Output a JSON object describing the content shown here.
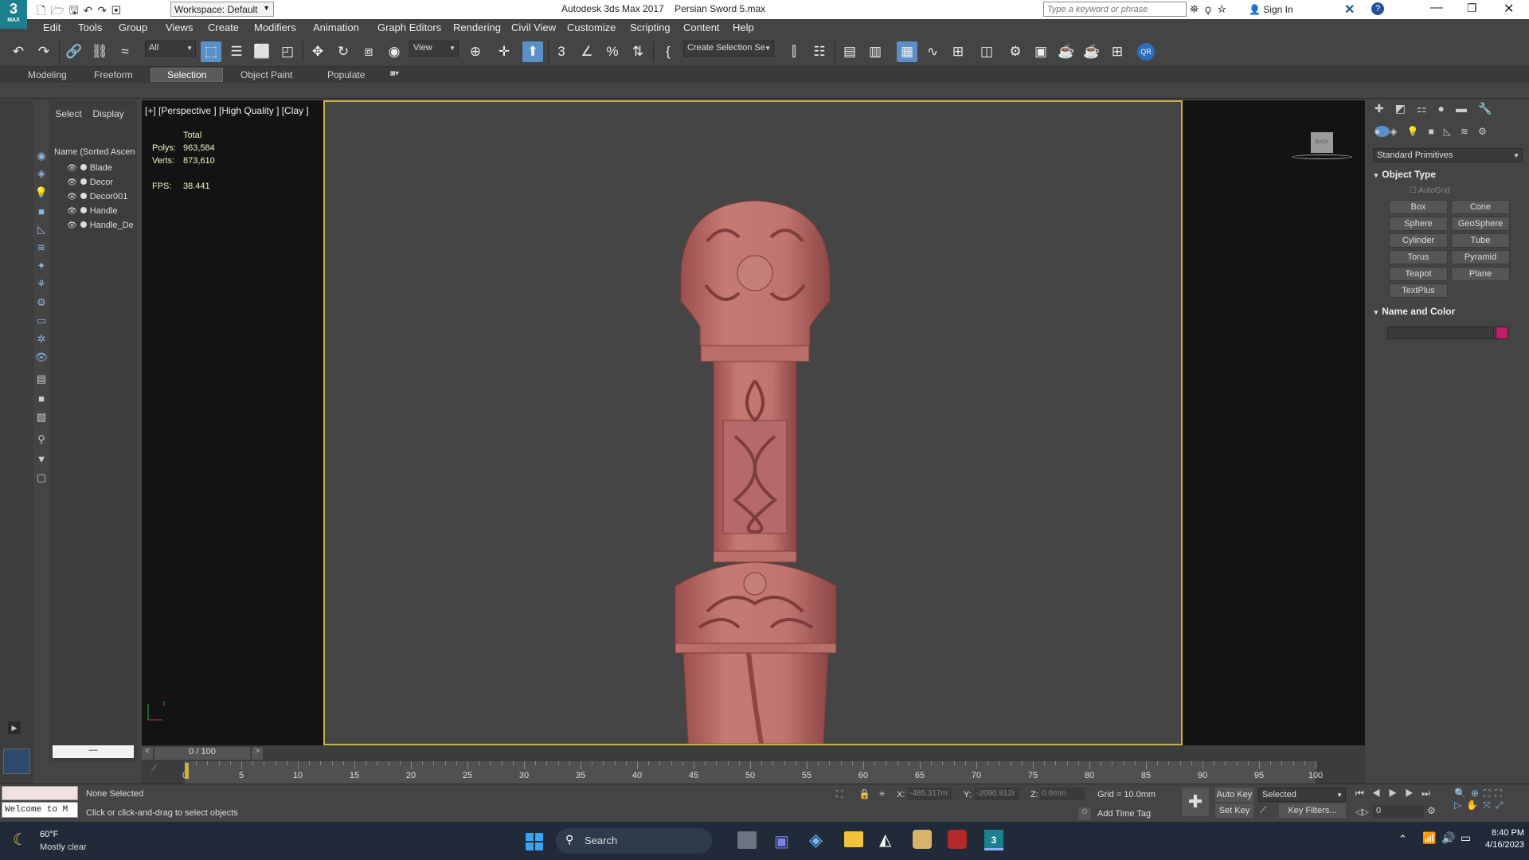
{
  "app": {
    "title": "Autodesk 3ds Max 2017",
    "file": "Persian Sword 5.max",
    "workspace": "Workspace: Default",
    "search_placeholder": "Type a keyword or phrase",
    "sign_in": "Sign In",
    "logo_text": "MAX"
  },
  "menus": [
    "Edit",
    "Tools",
    "Group",
    "Views",
    "Create",
    "Modifiers",
    "Animation",
    "Graph Editors",
    "Rendering",
    "Civil View",
    "Customize",
    "Scripting",
    "Content",
    "Help"
  ],
  "toolbar": {
    "filter_value": "All",
    "ref_coord": "View",
    "selection_set_placeholder": "Create Selection Se"
  },
  "ribbon": {
    "tabs": [
      "Modeling",
      "Freeform",
      "Selection",
      "Object Paint",
      "Populate"
    ],
    "active": "Selection"
  },
  "scene_explorer": {
    "tabs": [
      "Select",
      "Display"
    ],
    "header": "Name (Sorted Ascen",
    "items": [
      "Blade",
      "Decor",
      "Decor001",
      "Handle",
      "Handle_De"
    ]
  },
  "viewport": {
    "label": "[+] [Perspective ] [High Quality ] [Clay ]",
    "stats": {
      "total_label": "Total",
      "polys_label": "Polys:",
      "polys_value": "963,584",
      "verts_label": "Verts:",
      "verts_value": "873,610",
      "fps_label": "FPS:",
      "fps_value": "38.441"
    },
    "viewcube_label": "BACK",
    "colors": {
      "model": "#b86a66",
      "frame": "#c9b14a",
      "background": "#454545"
    }
  },
  "command_panel": {
    "dropdown": "Standard Primitives",
    "object_type_title": "Object Type",
    "autogrid": "AutoGrid",
    "buttons": [
      "Box",
      "Cone",
      "Sphere",
      "GeoSphere",
      "Cylinder",
      "Tube",
      "Torus",
      "Pyramid",
      "Teapot",
      "Plane",
      "TextPlus"
    ],
    "name_color_title": "Name and Color",
    "swatch_color": "#c0206a"
  },
  "timeline": {
    "slider_label": "0 / 100",
    "ticks": [
      0,
      5,
      10,
      15,
      20,
      25,
      30,
      35,
      40,
      45,
      50,
      55,
      60,
      65,
      70,
      75,
      80,
      85,
      90,
      95,
      100
    ]
  },
  "status": {
    "maxscript_text": "Welcome to M",
    "selection": "None Selected",
    "prompt": "Click or click-and-drag to select objects",
    "x_label": "X:",
    "x_value": "-485.317m",
    "y_label": "Y:",
    "y_value": "-2090.912r",
    "z_label": "Z:",
    "z_value": "0.0mm",
    "grid": "Grid = 10.0mm",
    "add_time_tag": "Add Time Tag",
    "auto_key": "Auto Key",
    "set_key": "Set Key",
    "selected_dropdown": "Selected",
    "key_filters": "Key Filters...",
    "frame_value": "0"
  },
  "taskbar": {
    "weather_temp": "60°F",
    "weather_desc": "Mostly clear",
    "search": "Search",
    "time": "8:40 PM",
    "date": "4/16/2023"
  }
}
